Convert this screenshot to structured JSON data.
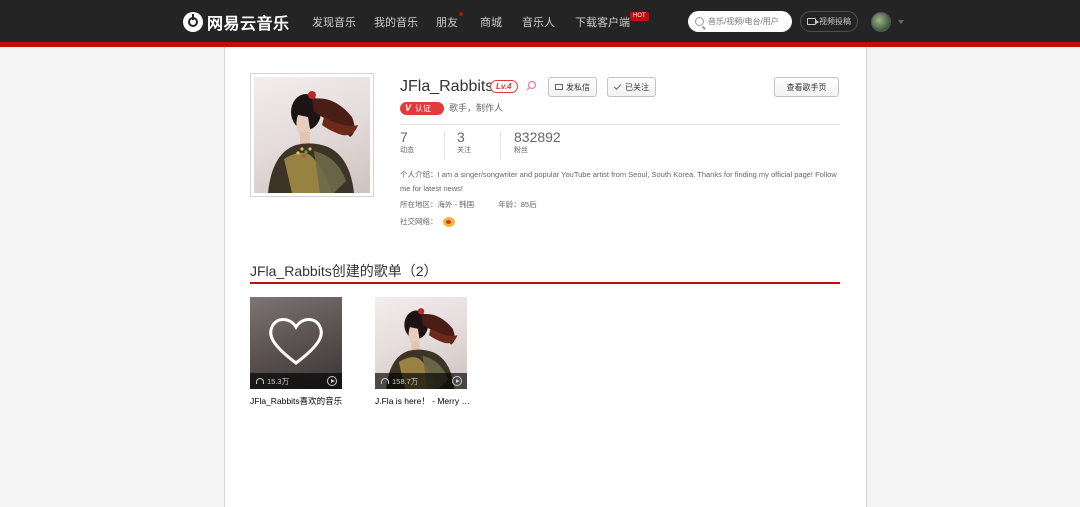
{
  "header": {
    "logo_text": "网易云音乐",
    "nav": [
      {
        "label": "发现音乐"
      },
      {
        "label": "我的音乐"
      },
      {
        "label": "朋友"
      },
      {
        "label": "商城"
      },
      {
        "label": "音乐人"
      },
      {
        "label": "下载客户端"
      }
    ],
    "hot_badge": "HOT",
    "search_placeholder": "音乐/视频/电台/用户",
    "upload_label": "视频投稿",
    "accent": "#c20c0c"
  },
  "profile": {
    "username": "JFla_Rabbits",
    "level": "Lv.4",
    "message_label": "发私信",
    "follow_label": "已关注",
    "artist_page_label": "查看歌手页",
    "verify_label": "认证",
    "role": "歌手，制作人",
    "stats": [
      {
        "value": "7",
        "label": "动态"
      },
      {
        "value": "3",
        "label": "关注"
      },
      {
        "value": "832892",
        "label": "粉丝"
      }
    ],
    "intro": "个人介绍：I am a singer/songwriter and popular YouTube artist from Seoul, South Korea. Thanks for finding my official page! Follow me for latest news!",
    "location": "所在地区：海外 - 韩国",
    "age": "年龄：85后",
    "social_label": "社交网络："
  },
  "playlists": {
    "title": "JFla_Rabbits创建的歌单（2）",
    "items": [
      {
        "name": "JFla_Rabbits喜欢的音乐",
        "plays": "15.3万"
      },
      {
        "name": "J.Fla is here！ - Merry Christmas",
        "plays": "158.7万"
      }
    ]
  }
}
